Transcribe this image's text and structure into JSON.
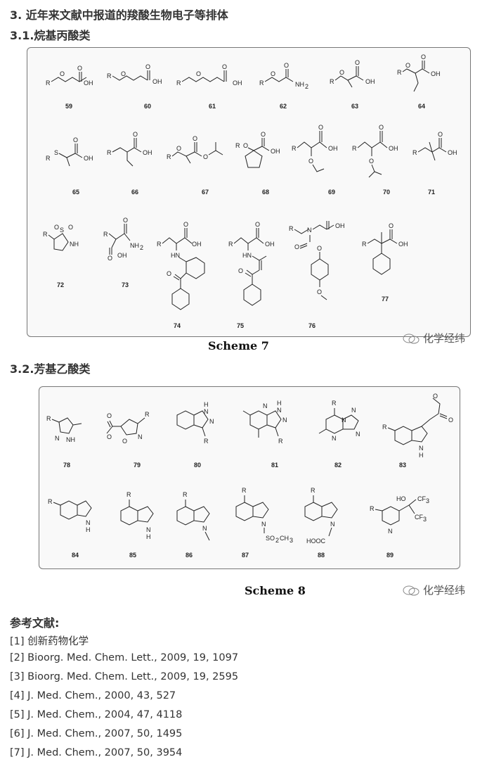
{
  "section_title": "3. 近年来文献中报道的羧酸生物电子等排体",
  "sub1": "3.1.烷基丙酸类",
  "sub2": "3.2.芳基乙酸类",
  "scheme7": "Scheme 7",
  "scheme8": "Scheme 8",
  "watermark": "化学经纬",
  "refs_title": "参考文献:",
  "references": [
    "[1] 创新药物化学",
    "[2] Bioorg. Med. Chem. Lett., 2009, 19, 1097",
    "[3] Bioorg. Med. Chem. Lett., 2009, 19, 2595",
    "[4] J. Med. Chem., 2000, 43, 527",
    "[5] J. Med. Chem., 2004, 47, 4118",
    "[6] J. Med. Chem., 2007, 50, 1495",
    "[7] J. Med. Chem., 2007, 50, 3954"
  ],
  "compounds7": [
    "59",
    "60",
    "61",
    "62",
    "63",
    "64",
    "65",
    "66",
    "67",
    "68",
    "69",
    "70",
    "71",
    "72",
    "73",
    "74",
    "75",
    "76",
    "77"
  ],
  "compounds8": [
    "78",
    "79",
    "80",
    "81",
    "82",
    "83",
    "84",
    "85",
    "86",
    "87",
    "88",
    "89"
  ],
  "atoms": {
    "R": "R",
    "O": "O",
    "OH": "OH",
    "NH2": "NH",
    "NH2sub": "2",
    "S": "S",
    "N": "N",
    "NH": "NH",
    "HN": "HN",
    "H": "H",
    "SO2CH3": "SO",
    "SO2sub": "2",
    "CH3": "CH",
    "CH3sub": "3",
    "HOOC": "HOOC",
    "HO": "HO",
    "CF3": "CF",
    "CF3sub": "3"
  }
}
